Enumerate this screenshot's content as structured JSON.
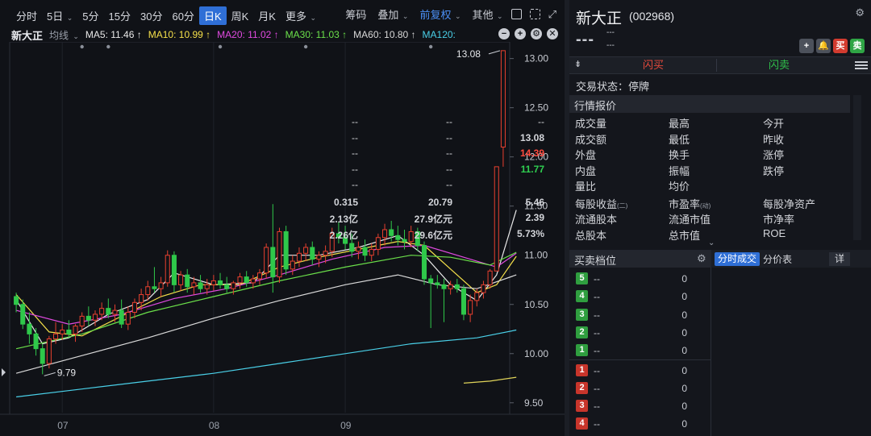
{
  "toolbar": {
    "periods": [
      {
        "label": "分时",
        "dropdown": false
      },
      {
        "label": "5日",
        "dropdown": true
      },
      {
        "label": "5分",
        "dropdown": false
      },
      {
        "label": "15分",
        "dropdown": false
      },
      {
        "label": "30分",
        "dropdown": false
      },
      {
        "label": "60分",
        "dropdown": false
      },
      {
        "label": "日K",
        "dropdown": false,
        "active": true
      },
      {
        "label": "周K",
        "dropdown": false
      },
      {
        "label": "月K",
        "dropdown": false
      },
      {
        "label": "更多",
        "dropdown": true
      }
    ],
    "tools": [
      {
        "label": "筹码",
        "color": "default"
      },
      {
        "label": "叠加",
        "dropdown": true,
        "color": "default"
      },
      {
        "label": "前复权",
        "dropdown": true,
        "color": "blue"
      },
      {
        "label": "其他",
        "dropdown": true,
        "color": "default"
      }
    ]
  },
  "ma_bar": {
    "name": "新大正",
    "mode": "均线",
    "mode_caret": "⌄",
    "items": [
      {
        "label": "MA5: 11.46 ↑",
        "color": "#e8e8e8"
      },
      {
        "label": "MA10: 10.99 ↑",
        "color": "#f5e04a"
      },
      {
        "label": "MA20: 11.02 ↑",
        "color": "#e04ae0"
      },
      {
        "label": "MA30: 11.03 ↑",
        "color": "#6be04a"
      },
      {
        "label": "MA60: 10.80 ↑",
        "color": "#d9d9d9"
      },
      {
        "label": "MA120:",
        "color": "#4ad0e8"
      }
    ],
    "controls": [
      "−",
      "+",
      "⚙",
      "✕"
    ]
  },
  "chart_data": {
    "type": "candlestick",
    "y_ticks": [
      "13.00",
      "12.50",
      "12.00",
      "11.50",
      "11.00",
      "10.50",
      "10.00",
      "9.50"
    ],
    "x_ticks": [
      "07",
      "08",
      "09"
    ],
    "ylim": [
      9.4,
      13.12
    ],
    "high_label": "13.08",
    "low_label": "9.79",
    "up_color": "#e8402f",
    "down_color": "#2fc84a",
    "candles": [
      [
        10.58,
        10.62,
        10.42,
        10.5
      ],
      [
        10.5,
        10.55,
        10.25,
        10.3
      ],
      [
        10.3,
        10.42,
        10.1,
        10.2
      ],
      [
        10.2,
        10.26,
        9.98,
        10.05
      ],
      [
        10.05,
        10.1,
        9.79,
        9.9
      ],
      [
        9.9,
        10.18,
        9.85,
        10.15
      ],
      [
        10.15,
        10.32,
        10.1,
        10.2
      ],
      [
        10.2,
        10.3,
        10.14,
        10.24
      ],
      [
        10.24,
        10.34,
        10.16,
        10.2
      ],
      [
        10.2,
        10.3,
        10.12,
        10.28
      ],
      [
        10.28,
        10.42,
        10.22,
        10.38
      ],
      [
        10.38,
        10.48,
        10.28,
        10.34
      ],
      [
        10.34,
        10.44,
        10.28,
        10.4
      ],
      [
        10.4,
        10.52,
        10.34,
        10.46
      ],
      [
        10.46,
        10.56,
        10.36,
        10.4
      ],
      [
        10.4,
        10.5,
        10.32,
        10.44
      ],
      [
        10.44,
        10.55,
        10.26,
        10.3
      ],
      [
        10.3,
        10.48,
        10.24,
        10.42
      ],
      [
        10.42,
        10.56,
        10.36,
        10.52
      ],
      [
        10.52,
        10.66,
        10.44,
        10.6
      ],
      [
        10.6,
        10.74,
        10.54,
        10.68
      ],
      [
        10.68,
        10.88,
        10.62,
        10.66
      ],
      [
        10.66,
        10.78,
        10.58,
        10.72
      ],
      [
        10.72,
        11.05,
        10.68,
        11.0
      ],
      [
        11.0,
        11.04,
        10.62,
        10.7
      ],
      [
        10.7,
        10.84,
        10.64,
        10.8
      ],
      [
        10.8,
        10.86,
        10.62,
        10.68
      ],
      [
        10.68,
        10.78,
        10.6,
        10.72
      ],
      [
        10.72,
        10.8,
        10.62,
        10.66
      ],
      [
        10.66,
        10.76,
        10.6,
        10.7
      ],
      [
        10.7,
        10.8,
        10.64,
        10.74
      ],
      [
        10.74,
        10.82,
        10.66,
        10.7
      ],
      [
        10.7,
        10.78,
        10.62,
        10.66
      ],
      [
        10.66,
        10.74,
        10.6,
        10.72
      ],
      [
        10.72,
        10.82,
        10.66,
        10.78
      ],
      [
        10.78,
        10.84,
        10.68,
        10.72
      ],
      [
        10.72,
        10.8,
        10.66,
        10.76
      ],
      [
        10.76,
        10.86,
        10.7,
        10.82
      ],
      [
        10.82,
        11.12,
        10.76,
        11.08
      ],
      [
        11.08,
        11.52,
        10.62,
        10.78
      ],
      [
        10.78,
        11.28,
        10.72,
        11.24
      ],
      [
        11.24,
        11.3,
        10.8,
        10.86
      ],
      [
        10.86,
        11.0,
        10.8,
        10.94
      ],
      [
        10.94,
        11.08,
        10.88,
        11.02
      ],
      [
        11.02,
        11.12,
        10.94,
        11.08
      ],
      [
        11.08,
        11.14,
        10.9,
        10.96
      ],
      [
        10.96,
        11.04,
        10.88,
        11.0
      ],
      [
        11.0,
        11.1,
        10.92,
        11.04
      ],
      [
        11.04,
        11.28,
        10.98,
        11.22
      ],
      [
        11.22,
        11.34,
        11.12,
        11.18
      ],
      [
        11.18,
        11.3,
        11.06,
        11.12
      ],
      [
        11.12,
        11.22,
        10.98,
        11.04
      ],
      [
        11.04,
        11.14,
        10.96,
        11.08
      ],
      [
        11.08,
        11.16,
        10.94,
        11.0
      ],
      [
        11.0,
        11.12,
        10.94,
        11.06
      ],
      [
        11.06,
        11.22,
        11.0,
        11.18
      ],
      [
        11.18,
        11.32,
        11.1,
        11.26
      ],
      [
        11.26,
        11.35,
        11.14,
        11.2
      ],
      [
        11.2,
        11.3,
        11.1,
        11.16
      ],
      [
        11.16,
        11.26,
        11.06,
        11.14
      ],
      [
        11.14,
        11.3,
        11.08,
        11.24
      ],
      [
        11.24,
        11.28,
        11.04,
        11.1
      ],
      [
        11.1,
        11.14,
        10.7,
        10.76
      ],
      [
        10.76,
        10.8,
        10.26,
        10.72
      ],
      [
        10.72,
        10.8,
        10.66,
        10.7
      ],
      [
        10.7,
        10.76,
        10.32,
        10.66
      ],
      [
        10.66,
        10.74,
        10.6,
        10.7
      ],
      [
        10.7,
        10.76,
        10.62,
        10.66
      ],
      [
        10.66,
        10.7,
        10.34,
        10.4
      ],
      [
        10.4,
        10.6,
        10.32,
        10.54
      ],
      [
        10.54,
        10.66,
        10.48,
        10.62
      ],
      [
        10.62,
        10.74,
        10.56,
        10.7
      ],
      [
        10.7,
        10.86,
        10.66,
        10.84
      ],
      [
        10.84,
        11.9,
        10.84,
        11.9
      ],
      [
        12.1,
        13.08,
        11.9,
        13.08
      ]
    ],
    "ma_lines": [
      {
        "name": "MA5",
        "color": "#e8e8e8",
        "values": [
          [
            0,
            10.55
          ],
          [
            4,
            10.1
          ],
          [
            8,
            10.16
          ],
          [
            14,
            10.4
          ],
          [
            20,
            10.55
          ],
          [
            24,
            10.82
          ],
          [
            30,
            10.7
          ],
          [
            36,
            10.72
          ],
          [
            40,
            11.0
          ],
          [
            46,
            11.0
          ],
          [
            52,
            11.08
          ],
          [
            58,
            11.2
          ],
          [
            62,
            11.0
          ],
          [
            66,
            10.7
          ],
          [
            70,
            10.54
          ],
          [
            73,
            10.8
          ],
          [
            76,
            11.46
          ]
        ]
      },
      {
        "name": "MA10",
        "color": "#f5e04a",
        "values": [
          [
            0,
            10.6
          ],
          [
            5,
            10.22
          ],
          [
            10,
            10.18
          ],
          [
            16,
            10.38
          ],
          [
            22,
            10.58
          ],
          [
            28,
            10.7
          ],
          [
            34,
            10.7
          ],
          [
            40,
            10.88
          ],
          [
            46,
            10.98
          ],
          [
            52,
            11.06
          ],
          [
            58,
            11.14
          ],
          [
            62,
            11.1
          ],
          [
            66,
            10.86
          ],
          [
            70,
            10.62
          ],
          [
            73,
            10.7
          ],
          [
            76,
            10.99
          ]
        ]
      },
      {
        "name": "MA20",
        "color": "#e04ae0",
        "values": [
          [
            0,
            10.44
          ],
          [
            8,
            10.3
          ],
          [
            16,
            10.4
          ],
          [
            24,
            10.56
          ],
          [
            32,
            10.66
          ],
          [
            40,
            10.8
          ],
          [
            48,
            10.96
          ],
          [
            56,
            11.08
          ],
          [
            62,
            11.1
          ],
          [
            68,
            10.98
          ],
          [
            73,
            10.88
          ],
          [
            76,
            11.02
          ]
        ]
      },
      {
        "name": "MA30",
        "color": "#6be04a",
        "values": [
          [
            0,
            10.05
          ],
          [
            10,
            10.2
          ],
          [
            20,
            10.42
          ],
          [
            30,
            10.58
          ],
          [
            40,
            10.74
          ],
          [
            50,
            10.88
          ],
          [
            60,
            11.0
          ],
          [
            66,
            10.98
          ],
          [
            72,
            10.9
          ],
          [
            76,
            11.03
          ]
        ]
      },
      {
        "name": "MA60",
        "color": "#d9d9d9",
        "values": [
          [
            0,
            9.8
          ],
          [
            10,
            9.98
          ],
          [
            20,
            10.16
          ],
          [
            30,
            10.36
          ],
          [
            40,
            10.54
          ],
          [
            50,
            10.7
          ],
          [
            58,
            10.8
          ],
          [
            64,
            10.7
          ],
          [
            70,
            10.66
          ],
          [
            76,
            10.8
          ]
        ]
      },
      {
        "name": "MA120",
        "color": "#4ad0e8",
        "values": [
          [
            0,
            9.56
          ],
          [
            10,
            9.64
          ],
          [
            20,
            9.72
          ],
          [
            30,
            9.8
          ],
          [
            40,
            9.9
          ],
          [
            50,
            10.0
          ],
          [
            60,
            10.1
          ],
          [
            70,
            10.16
          ],
          [
            76,
            10.24
          ]
        ]
      },
      {
        "name": "MA250",
        "color": "#e0d45a",
        "values": [
          [
            68,
            9.7
          ],
          [
            72,
            9.72
          ],
          [
            76,
            9.76
          ]
        ]
      }
    ]
  },
  "stock": {
    "name": "新大正",
    "code": "(002968)",
    "price": "---",
    "change": "---",
    "change_pct": "---",
    "buttons": [
      {
        "label": "+",
        "style": "grey"
      },
      {
        "label": "🔔",
        "style": "grey"
      },
      {
        "label": "买",
        "style": "red"
      },
      {
        "label": "卖",
        "style": "green"
      }
    ]
  },
  "flash": {
    "buy": "闪买",
    "sell": "闪卖"
  },
  "trade_status": "交易状态：停牌",
  "quote": {
    "title": "行情报价",
    "rows": [
      [
        "成交量",
        "--",
        "最高",
        "--",
        "今开",
        "--"
      ],
      [
        "成交额",
        "--",
        "最低",
        "--",
        "昨收",
        "13.08"
      ],
      [
        "外盘",
        "--",
        "换手",
        "--",
        "涨停",
        "14.39"
      ],
      [
        "内盘",
        "--",
        "振幅",
        "--",
        "跌停",
        "11.77"
      ],
      [
        "量比",
        "--",
        "均价",
        "--",
        "",
        ""
      ],
      [
        "每股收益",
        "0.315",
        "市盈率",
        "20.79",
        "每股净资产",
        "5.46"
      ],
      [
        "流通股本",
        "2.13亿",
        "流通市值",
        "27.9亿元",
        "市净率",
        "2.39"
      ],
      [
        "总股本",
        "2.26亿",
        "总市值",
        "29.6亿元",
        "ROE",
        "5.73%"
      ]
    ],
    "eps_suffix": "(二)",
    "pe_suffix": "(动)"
  },
  "order_book": {
    "title": "买卖档位",
    "tabs": [
      "分时成交",
      "分价表",
      "详"
    ],
    "asks": [
      [
        "5",
        "--",
        "0"
      ],
      [
        "4",
        "--",
        "0"
      ],
      [
        "3",
        "--",
        "0"
      ],
      [
        "2",
        "--",
        "0"
      ],
      [
        "1",
        "--",
        "0"
      ]
    ],
    "bids": [
      [
        "1",
        "--",
        "0"
      ],
      [
        "2",
        "--",
        "0"
      ],
      [
        "3",
        "--",
        "0"
      ],
      [
        "4",
        "--",
        "0"
      ]
    ]
  }
}
